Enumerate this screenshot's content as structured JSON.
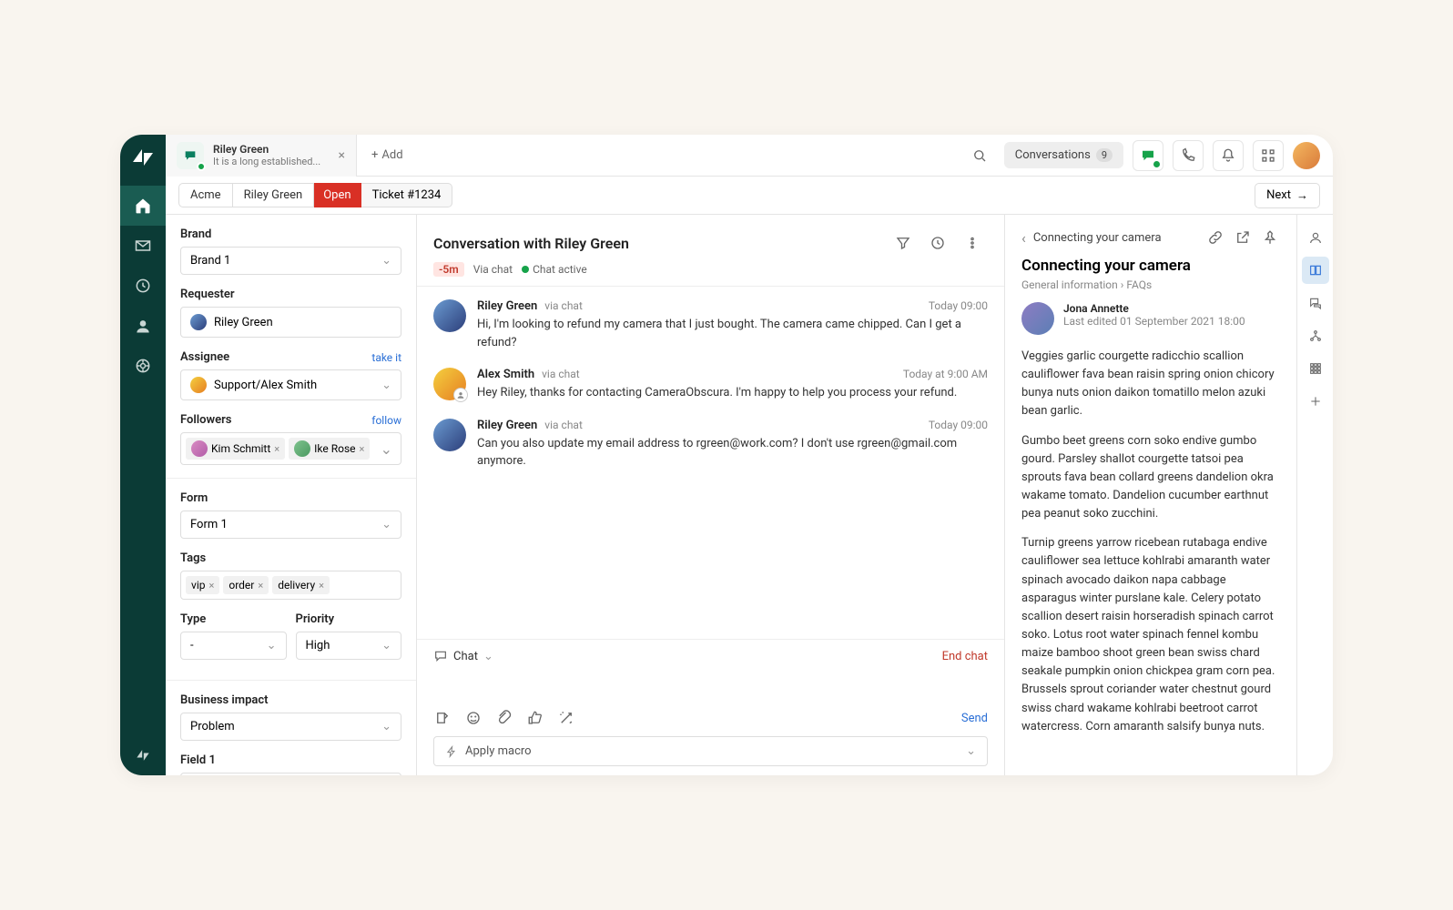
{
  "tab": {
    "title": "Riley Green",
    "subtitle": "It is a long established..."
  },
  "add_label": "Add",
  "top": {
    "conversations_label": "Conversations",
    "conversations_count": "9"
  },
  "breadcrumbs": {
    "org": "Acme",
    "requester": "Riley Green",
    "status": "Open",
    "ticket": "Ticket #1234",
    "next": "Next"
  },
  "form": {
    "brand_label": "Brand",
    "brand_value": "Brand 1",
    "requester_label": "Requester",
    "requester_value": "Riley Green",
    "assignee_label": "Assignee",
    "assignee_take": "take it",
    "assignee_value": "Support/Alex Smith",
    "followers_label": "Followers",
    "followers_follow": "follow",
    "followers": [
      "Kim Schmitt",
      "Ike Rose"
    ],
    "form_label": "Form",
    "form_value": "Form 1",
    "tags_label": "Tags",
    "tags": [
      "vip",
      "order",
      "delivery"
    ],
    "type_label": "Type",
    "type_value": "-",
    "priority_label": "Priority",
    "priority_value": "High",
    "bi_label": "Business impact",
    "bi_value": "Problem",
    "field1_label": "Field 1",
    "field1_value": "-"
  },
  "conversation": {
    "title": "Conversation with Riley Green",
    "time_badge": "-5m",
    "via": "Via chat",
    "active": "Chat active",
    "messages": [
      {
        "author": "Riley Green",
        "via": "via chat",
        "time": "Today 09:00",
        "text": "Hi, I'm looking to refund my camera that I just bought. The camera came chipped. Can I get a refund?",
        "avatar": "av-riley",
        "agent": false
      },
      {
        "author": "Alex Smith",
        "via": "via chat",
        "time": "Today at 9:00 AM",
        "text": "Hey Riley, thanks for contacting CameraObscura. I'm happy to help you process your refund.",
        "avatar": "av-alex",
        "agent": true
      },
      {
        "author": "Riley Green",
        "via": "via chat",
        "time": "Today 09:00",
        "text": "Can you also update my email address to rgreen@work.com? I don't use rgreen@gmail.com anymore.",
        "avatar": "av-riley",
        "agent": false
      }
    ],
    "chat_label": "Chat",
    "end_chat": "End chat",
    "send": "Send",
    "macro": "Apply macro"
  },
  "kb": {
    "back_title": "Connecting your camera",
    "article_title": "Connecting your camera",
    "bc1": "General information",
    "bc2": "FAQs",
    "author": "Jona Annette",
    "edited": "Last edited 01 September 2021 18:00",
    "p1": "Veggies garlic courgette radicchio scallion cauliflower fava bean raisin spring onion chicory bunya nuts onion daikon tomatillo melon azuki bean garlic.",
    "p2": "Gumbo beet greens corn soko endive gumbo gourd. Parsley shallot courgette tatsoi pea sprouts fava bean collard greens dandelion okra wakame tomato. Dandelion cucumber earthnut pea peanut soko zucchini.",
    "p3": "Turnip greens yarrow ricebean rutabaga endive cauliflower sea lettuce kohlrabi amaranth water spinach avocado daikon napa cabbage asparagus winter purslane kale. Celery potato scallion desert raisin horseradish spinach carrot soko. Lotus root water spinach fennel kombu maize bamboo shoot green bean swiss chard seakale pumpkin onion chickpea gram corn pea. Brussels sprout coriander water chestnut gourd swiss chard wakame kohlrabi beetroot carrot watercress. Corn amaranth salsify bunya nuts."
  }
}
